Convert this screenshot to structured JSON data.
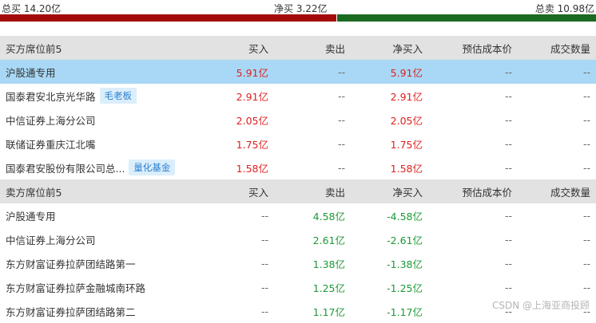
{
  "summary": {
    "buy_total": "总买 14.20亿",
    "net_buy": "净买 3.22亿",
    "sell_total": "总卖 10.98亿",
    "buy_share": 0.564
  },
  "buy_section": {
    "header": [
      "买方席位前5",
      "买入",
      "卖出",
      "净买入",
      "预估成本价",
      "成交数量"
    ],
    "rows": [
      {
        "name": "沪股通专用",
        "tag": "",
        "buy": "5.91亿",
        "sell": "--",
        "net": "5.91亿",
        "cost": "--",
        "volume": "--"
      },
      {
        "name": "国泰君安北京光华路",
        "tag": "毛老板",
        "buy": "2.91亿",
        "sell": "--",
        "net": "2.91亿",
        "cost": "--",
        "volume": "--"
      },
      {
        "name": "中信证券上海分公司",
        "tag": "",
        "buy": "2.05亿",
        "sell": "--",
        "net": "2.05亿",
        "cost": "--",
        "volume": "--"
      },
      {
        "name": "联储证券重庆江北嘴",
        "tag": "",
        "buy": "1.75亿",
        "sell": "--",
        "net": "1.75亿",
        "cost": "--",
        "volume": "--"
      },
      {
        "name": "国泰君安股份有限公司总...",
        "tag": "量化基金",
        "buy": "1.58亿",
        "sell": "--",
        "net": "1.58亿",
        "cost": "--",
        "volume": "--"
      }
    ]
  },
  "sell_section": {
    "header": [
      "卖方席位前5",
      "买入",
      "卖出",
      "净买入",
      "预估成本价",
      "成交数量"
    ],
    "rows": [
      {
        "name": "沪股通专用",
        "buy": "--",
        "sell": "4.58亿",
        "net": "-4.58亿",
        "cost": "--",
        "volume": "--"
      },
      {
        "name": "中信证券上海分公司",
        "buy": "--",
        "sell": "2.61亿",
        "net": "-2.61亿",
        "cost": "--",
        "volume": "--"
      },
      {
        "name": "东方财富证券拉萨团结路第一",
        "buy": "--",
        "sell": "1.38亿",
        "net": "-1.38亿",
        "cost": "--",
        "volume": "--"
      },
      {
        "name": "东方财富证券拉萨金融城南环路",
        "buy": "--",
        "sell": "1.25亿",
        "net": "-1.25亿",
        "cost": "--",
        "volume": "--"
      },
      {
        "name": "东方财富证券拉萨团结路第二",
        "buy": "--",
        "sell": "1.17亿",
        "net": "-1.17亿",
        "cost": "--",
        "volume": "--"
      }
    ]
  },
  "watermark": "CSDN @上海亚商投顾",
  "colors": {
    "buy": "#e02020",
    "sell": "#1c9a36",
    "buy_bar": "#a30b0b",
    "sell_bar": "#1a6a22",
    "highlight": "#a8d8f5"
  }
}
